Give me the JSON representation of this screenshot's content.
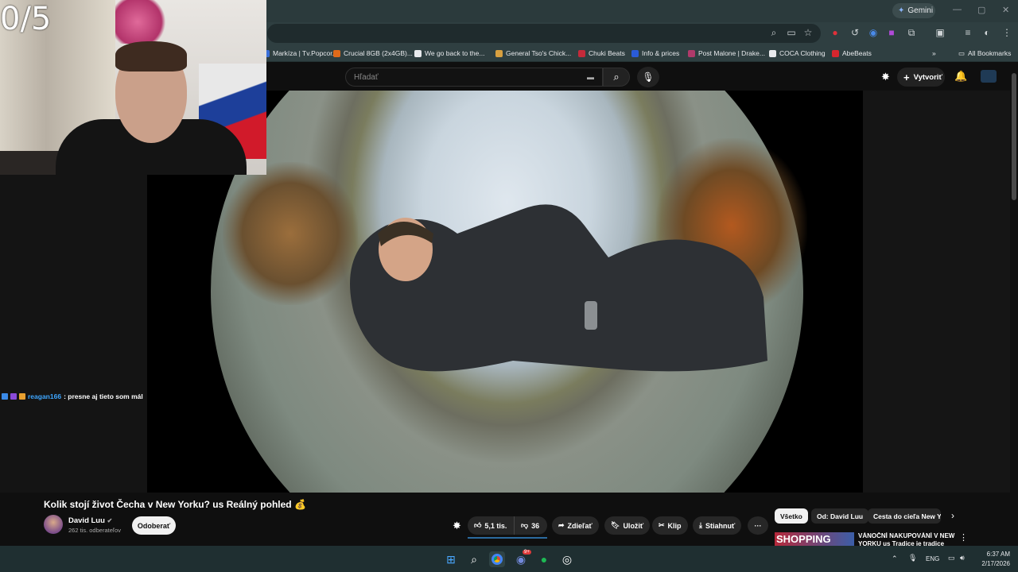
{
  "browser": {
    "gemini_label": "Gemini",
    "bookmarks": [
      {
        "label": "Markíza | Tv.Popcor...",
        "color": "#3a6fd8"
      },
      {
        "label": "Crucial 8GB (2x4GB)...",
        "color": "#e06a1a"
      },
      {
        "label": "We go back to the...",
        "color": "#e8eaed"
      },
      {
        "label": "General Tso's Chick...",
        "color": "#d8a040"
      },
      {
        "label": "Chuki Beats",
        "color": "#c42a3a"
      },
      {
        "label": "Info & prices",
        "color": "#2a5bd8"
      },
      {
        "label": "Post Malone | Drake...",
        "color": "#b03a6a"
      },
      {
        "label": "COCA Clothing",
        "color": "#e8eaed"
      },
      {
        "label": "AbeBeats",
        "color": "#d8262e"
      }
    ],
    "all_bookmarks_label": "All Bookmarks"
  },
  "youtube": {
    "search_placeholder": "Hľadať",
    "create_label": "Vytvoriť",
    "video_title": "Kolik stojí život Čecha v New Yorku? us Reálný pohled 💰",
    "channel_name": "David Luu",
    "subscriber_count": "262 tis. odberateľov",
    "subscribe_label": "Odoberať",
    "actions": {
      "likes": "5,1 tis.",
      "dislikes": "36",
      "share": "Zdieľať",
      "save": "Uložiť",
      "clip": "Klip",
      "download": "Stiahnuť",
      "more": "···"
    },
    "chips": [
      "Všetko",
      "Od: David Luu",
      "Cesta do cieľa New Yo"
    ],
    "recommendation": {
      "thumb_text": "SHOPPING",
      "title": "VÁNOČNÍ NAKUPOVÁNÍ V NEW YORKU us Tradice je tradice"
    }
  },
  "stream_overlay": {
    "counter": "0/5",
    "chat": {
      "username": "reagan166",
      "message": ": presne aj tieto som mál"
    }
  },
  "taskbar": {
    "language": "ENG",
    "time": "6:37 AM",
    "date": "2/17/2026",
    "discord_badge": "9+"
  }
}
